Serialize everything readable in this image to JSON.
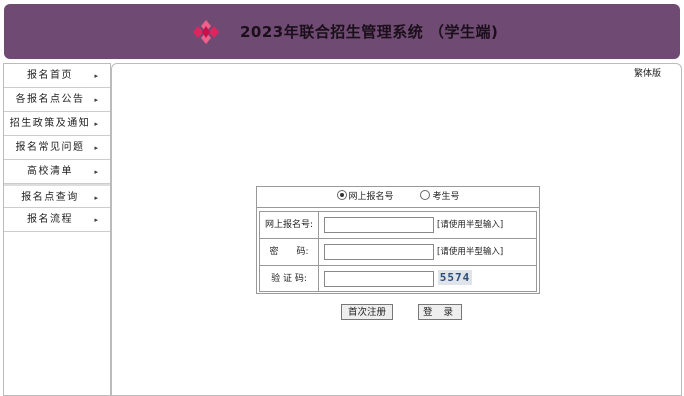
{
  "header": {
    "title": "2023年联合招生管理系统 （学生端)"
  },
  "sidebar": {
    "items": [
      {
        "label": "报名首页"
      },
      {
        "label": "各报名点公告"
      },
      {
        "label": "招生政策及通知"
      },
      {
        "label": "报名常见问题"
      },
      {
        "label": "高校清单"
      },
      {
        "label": "报名点查询"
      },
      {
        "label": "报名流程"
      }
    ],
    "arrow": "▸"
  },
  "main": {
    "traditional_link": "繁体版"
  },
  "login": {
    "radio_online": "网上报名号",
    "radio_student": "考生号",
    "selected": "网上报名号",
    "fields": [
      {
        "label": "网上报名号:",
        "value": "",
        "hint": "[请使用半型输入]"
      },
      {
        "label": "密　　码:",
        "value": "",
        "hint": "[请使用半型输入]"
      },
      {
        "label": "验 证 码:",
        "value": "",
        "captcha": "5574"
      }
    ],
    "register_button": "首次注册",
    "login_button": "登 录"
  },
  "colors": {
    "header_bg": "#6f4a72",
    "logo": "#e0245e"
  }
}
